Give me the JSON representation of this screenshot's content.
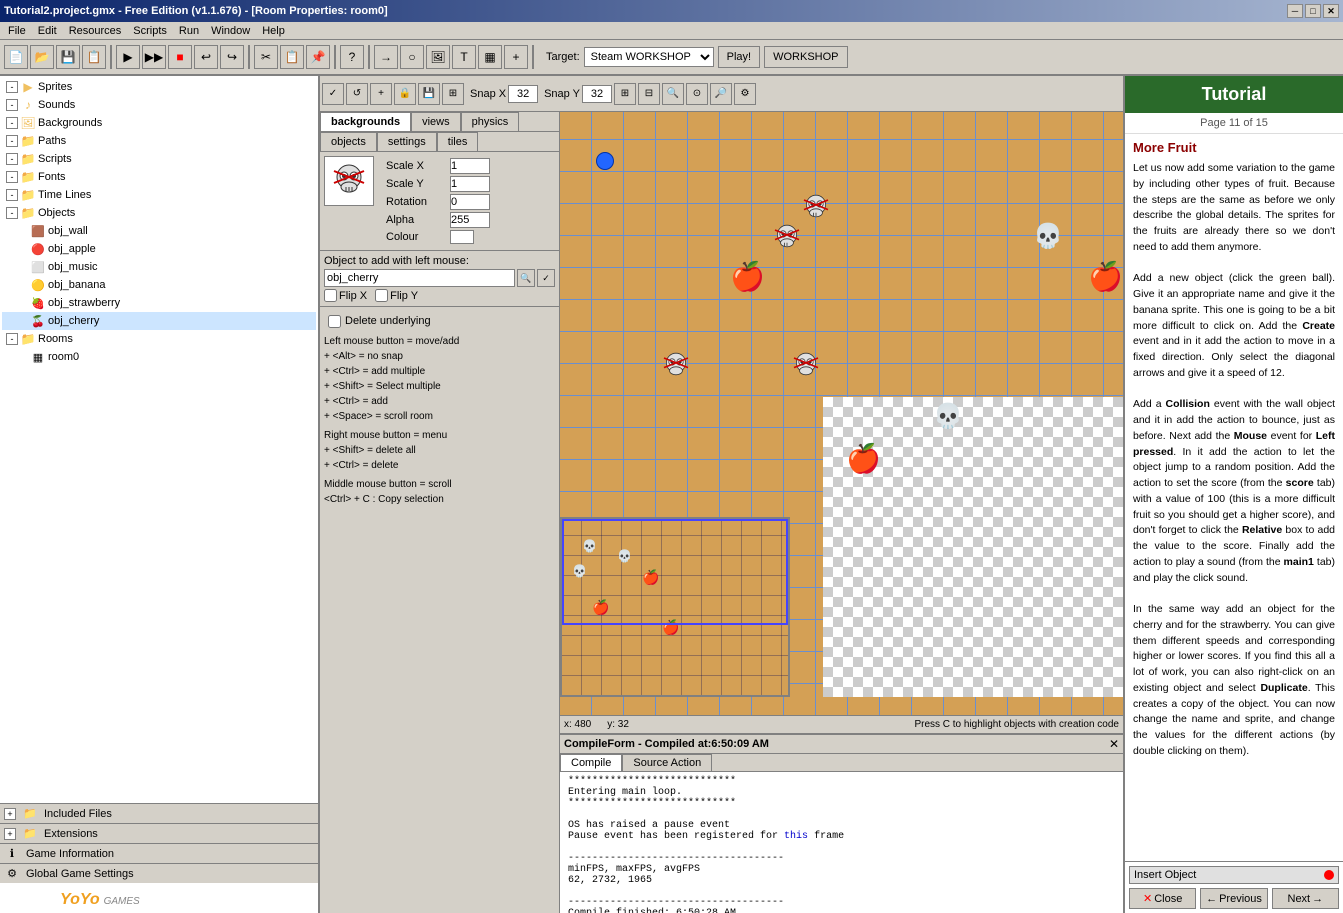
{
  "titleBar": {
    "title": "Tutorial2.project.gmx - Free Edition (v1.1.676) - [Room Properties: room0]",
    "buttons": [
      "minimize",
      "maximize",
      "close"
    ]
  },
  "menuBar": {
    "items": [
      "File",
      "Edit",
      "Resources",
      "Scripts",
      "Run",
      "Window",
      "Help"
    ]
  },
  "toolbar": {
    "target": {
      "label": "Target:",
      "value": "Steam WORKSHOP",
      "options": [
        "Steam WORKSHOP"
      ]
    },
    "playBtn": "Play!",
    "workshopBtn": "WORKSHOP"
  },
  "roomToolbar": {
    "snapX": {
      "label": "Snap X",
      "value": "32"
    },
    "snapY": {
      "label": "Snap Y",
      "value": "32"
    }
  },
  "roomTabs": [
    "backgrounds",
    "views",
    "physics",
    "objects",
    "settings",
    "tiles"
  ],
  "tree": {
    "items": [
      {
        "label": "Sprites",
        "type": "folder",
        "level": 0,
        "expanded": true
      },
      {
        "label": "Sounds",
        "type": "folder",
        "level": 0,
        "expanded": true
      },
      {
        "label": "Backgrounds",
        "type": "folder",
        "level": 0,
        "expanded": true
      },
      {
        "label": "Paths",
        "type": "folder",
        "level": 0,
        "expanded": true
      },
      {
        "label": "Scripts",
        "type": "folder",
        "level": 0,
        "expanded": true
      },
      {
        "label": "Fonts",
        "type": "folder",
        "level": 0,
        "expanded": true
      },
      {
        "label": "Time Lines",
        "type": "folder",
        "level": 0,
        "expanded": true
      },
      {
        "label": "Objects",
        "type": "folder",
        "level": 0,
        "expanded": true
      },
      {
        "label": "obj_wall",
        "type": "item",
        "level": 1
      },
      {
        "label": "obj_apple",
        "type": "item",
        "level": 1
      },
      {
        "label": "obj_music",
        "type": "item",
        "level": 1
      },
      {
        "label": "obj_banana",
        "type": "item",
        "level": 1
      },
      {
        "label": "obj_strawberry",
        "type": "item",
        "level": 1
      },
      {
        "label": "obj_cherry",
        "type": "item",
        "level": 1
      },
      {
        "label": "Rooms",
        "type": "folder",
        "level": 0,
        "expanded": true
      },
      {
        "label": "room0",
        "type": "item",
        "level": 1
      },
      {
        "label": "Included Files",
        "type": "section",
        "level": 0
      },
      {
        "label": "Extensions",
        "type": "section",
        "level": 0
      },
      {
        "label": "Game Information",
        "type": "item",
        "level": 0
      },
      {
        "label": "Global Game Settings",
        "type": "item",
        "level": 0
      }
    ]
  },
  "objSelector": {
    "scaleX": "1",
    "scaleY": "1",
    "rotation": "0",
    "alpha": "255",
    "colour": "white",
    "flipX": false,
    "flipY": false,
    "objectName": "obj_cherry",
    "objectToAdd": "Object to add with left mouse:"
  },
  "instructions": {
    "deleteUnderlying": "Delete underlying",
    "leftMouse": "Left mouse button = move/add",
    "alt": "  + <Alt> = no snap",
    "ctrlAdd": "  + <Ctrl> = add multiple",
    "shiftSelect": "  + <Shift> = Select multiple",
    "ctrlOnly": "  + <Ctrl> = add",
    "space": "  + <Space> = scroll room",
    "rightMouse": "Right mouse button = menu",
    "shiftDelete": "  + <Shift> = delete all",
    "ctrlDelete": "  + <Ctrl> = delete",
    "middleMouse": "Middle mouse button = scroll",
    "copySelection": "  <Ctrl> + C : Copy selection"
  },
  "status": {
    "x": "x: 480",
    "y": "y: 32",
    "hint": "Press C to highlight objects with creation code"
  },
  "compilePanel": {
    "title": "CompileForm - Compiled at:6:50:09 AM",
    "tabs": [
      "Compile",
      "Source Action"
    ],
    "output": [
      "****************************",
      "Entering main loop.",
      "****************************",
      "",
      "OS has raised a pause event",
      "Pause event has been registered for this frame",
      "",
      "------------------------------------",
      "minFPS, maxFPS, avgFPS",
      "62, 2732, 1965",
      "",
      "------------------------------------",
      "Compile finished: 6:50:28 AM"
    ]
  },
  "tutorial": {
    "title": "Tutorial",
    "page": "Page 11 of 15",
    "sectionTitle": "More Fruit",
    "body": "Let us now add some variation to the game by including other types of fruit. Because the steps are the same as before we only describe the global details. The sprites for the fruits are already there so we don't need to add them anymore.\n\nAdd a new object (click the green ball). Give it an appropriate name and give it the banana sprite. This one is going to be a bit more difficult to click on. Add the Create event and in it add the action to move in a fixed direction. Only select the diagonal arrows and give it a speed of 12.\n\nAdd a Collision event with the wall object and it in add the action to bounce, just as before. Next add the Mouse event for Left pressed. In it add the action to let the object jump to a random position. Add the action to set the score (from the score tab) with a value of 100 (this is a more difficult fruit so you should get a higher score), and don't forget to click the Relative box to add the value to the score. Finally add the action to play a sound (from the main1 tab) and play the click sound.\n\nIn the same way add an object for the cherry and for the strawberry. You can give them different speeds and corresponding higher or lower scores. If you find this all a lot of work, you can also right-click on an existing object and select Duplicate. This creates a copy of the object. You can now change the name and sprite, and change the values for the different actions (by double clicking on them).",
    "insertObject": "Insert Object",
    "navPrev": "Previous",
    "navNext": "Next",
    "navClose": "Close"
  },
  "yoyoLogo": "YoYo GAMES"
}
